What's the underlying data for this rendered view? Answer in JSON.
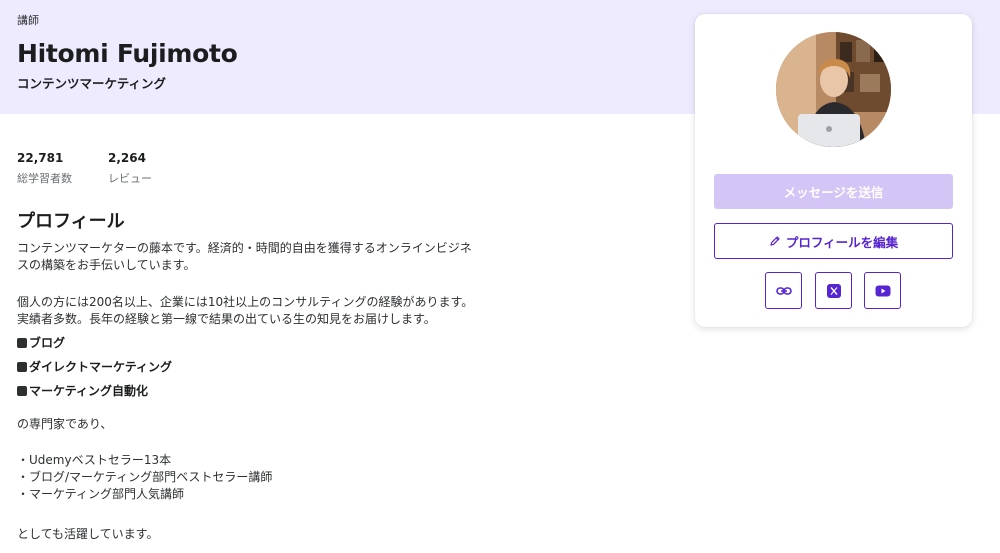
{
  "header": {
    "role_label": "講師",
    "name": "Hitomi Fujimoto",
    "headline": "コンテンツマーケティング"
  },
  "stats": [
    {
      "value": "22,781",
      "label": "総学習者数"
    },
    {
      "value": "2,264",
      "label": "レビュー"
    }
  ],
  "profile": {
    "title": "プロフィール",
    "paragraph1": "コンテンツマーケターの藤本です。経済的・時間的自由を獲得するオンラインビジネスの構築をお手伝いしています。",
    "paragraph2": "個人の方には200名以上、企業には10社以上のコンサルティングの経験があります。実績者多数。長年の経験と第一線で結果の出ている生の知見をお届けします。",
    "bold_bullets": [
      "ブログ",
      "ダイレクトマーケティング",
      "マーケティング自動化"
    ],
    "expert_line": "の専門家であり、",
    "achievements": [
      "・Udemyベストセラー13本",
      "・ブログ/マーケティング部門ベストセラー講師",
      "・マーケティング部門人気講師"
    ],
    "closing": "としても活躍しています。"
  },
  "card": {
    "message_button": "メッセージを送信",
    "edit_profile_button": "プロフィールを編集",
    "social_icons": [
      "link-icon",
      "x-icon",
      "youtube-icon"
    ]
  },
  "colors": {
    "hero_bg": "#eeebff",
    "accent": "#5624d0",
    "disabled_button": "#d3c5f6"
  }
}
